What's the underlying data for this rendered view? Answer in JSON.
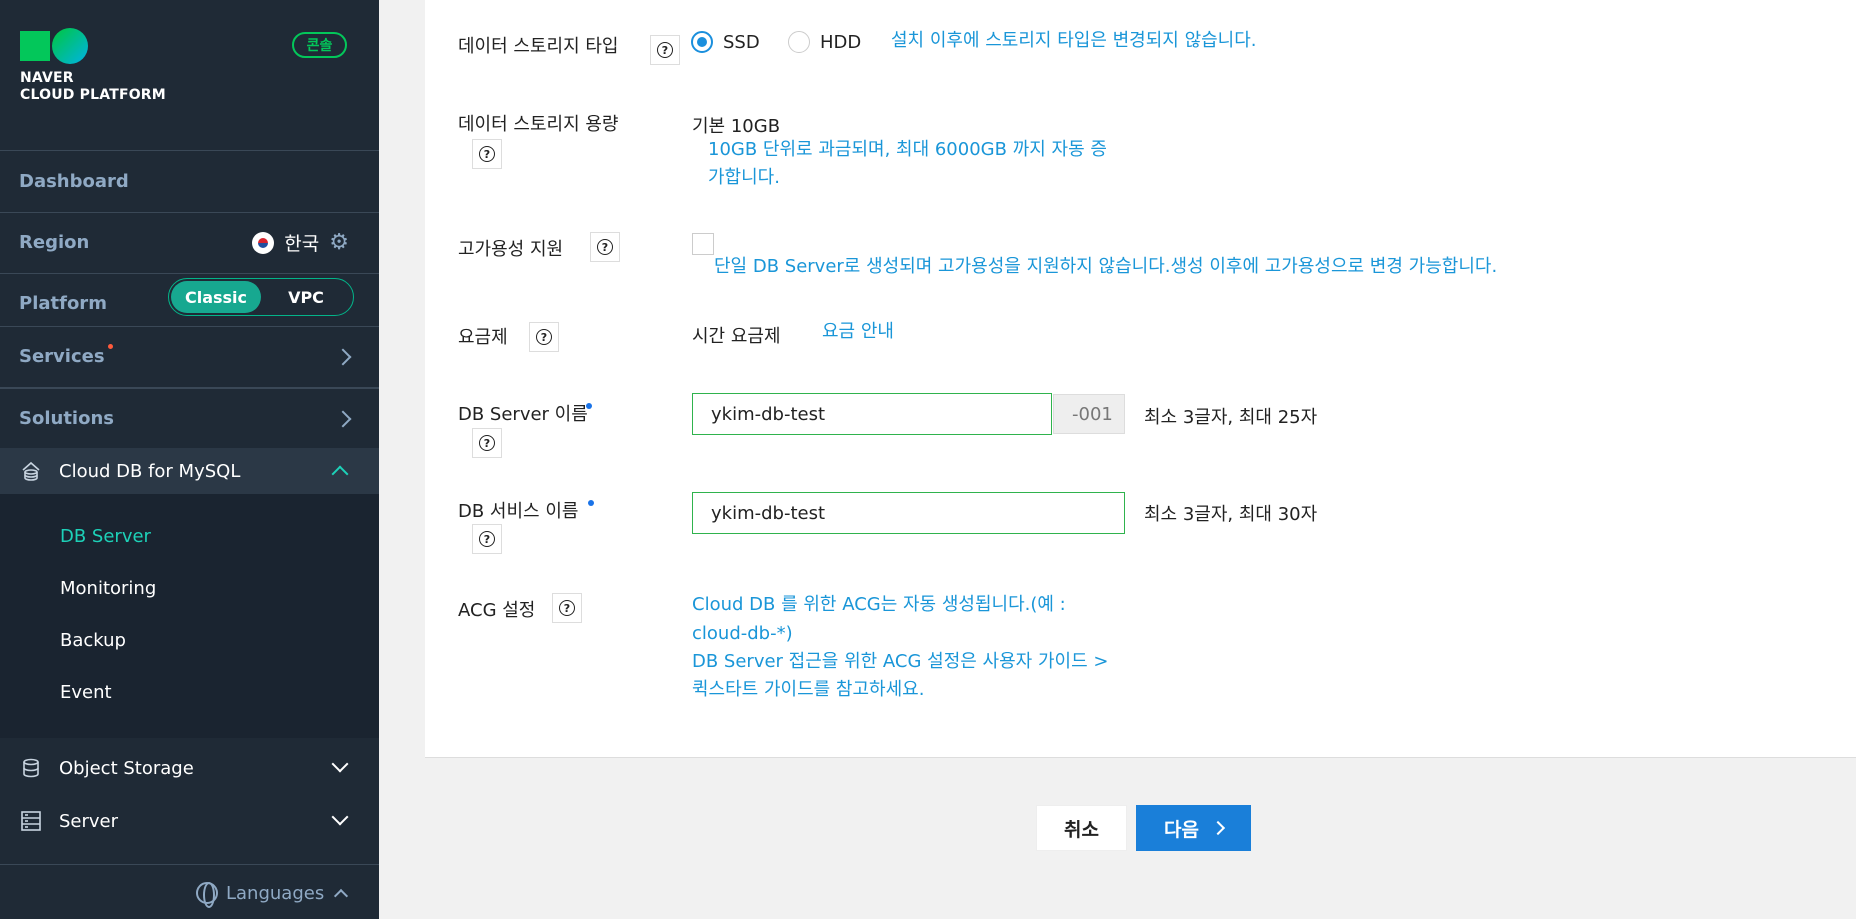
{
  "sidebar": {
    "logo_line1": "NAVER",
    "logo_line2": "CLOUD PLATFORM",
    "console_badge": "콘솔",
    "dashboard": "Dashboard",
    "region_label": "Region",
    "region_value": "한국",
    "platform_label": "Platform",
    "platform_options": [
      "Classic",
      "VPC"
    ],
    "platform_selected": "Classic",
    "services": "Services",
    "solutions": "Solutions",
    "active_section": "Cloud DB for MySQL",
    "sub_items": [
      "DB Server",
      "Monitoring",
      "Backup",
      "Event"
    ],
    "active_sub_item": "DB Server",
    "object_storage": "Object Storage",
    "server": "Server",
    "languages": "Languages"
  },
  "form": {
    "storage_type": {
      "label": "데이터 스토리지 타입",
      "options": [
        "SSD",
        "HDD"
      ],
      "selected": "SSD",
      "info": "설치 이후에 스토리지 타입은 변경되지 않습니다."
    },
    "storage_capacity": {
      "label": "데이터 스토리지 용량",
      "value": "기본 10GB",
      "info_line1": "10GB 단위로 과금되며, 최대 6000GB 까지 자동 증",
      "info_line2": "가합니다."
    },
    "high_availability": {
      "label": "고가용성 지원",
      "checked": false,
      "info": "단일 DB Server로 생성되며 고가용성을 지원하지 않습니다.생성 이후에 고가용성으로 변경 가능합니다."
    },
    "pricing": {
      "label": "요금제",
      "value": "시간 요금제",
      "link": "요금 안내"
    },
    "db_server_name": {
      "label": "DB Server 이름",
      "value": "ykim-db-test",
      "suffix": "-001",
      "hint": "최소 3글자, 최대 25자"
    },
    "db_service_name": {
      "label": "DB 서비스 이름",
      "value": "ykim-db-test",
      "hint": "최소 3글자, 최대 30자"
    },
    "acg": {
      "label": "ACG 설정",
      "info_line1": "Cloud DB 를 위한 ACG는 자동 생성됩니다.(예 :",
      "info_line2": "cloud-db-*)",
      "info_line3": "DB Server 접근을 위한 ACG 설정은 사용자 가이드 >",
      "info_line4": "퀵스타트 가이드를 참고하세요."
    },
    "help_glyph": "?"
  },
  "buttons": {
    "cancel": "취소",
    "next": "다음"
  },
  "colors": {
    "sidebar_bg": "#1f2a36",
    "accent_teal": "#1dd1b8",
    "info_blue": "#1a96d8",
    "primary_button": "#1a7fd9",
    "input_border_valid": "#2fb34d"
  },
  "icons": [
    "gear-icon",
    "korea-flag-icon",
    "database-icon",
    "object-storage-icon",
    "server-icon",
    "globe-icon",
    "help-icon",
    "chevron-right-icon",
    "chevron-down-icon",
    "chevron-up-icon"
  ]
}
